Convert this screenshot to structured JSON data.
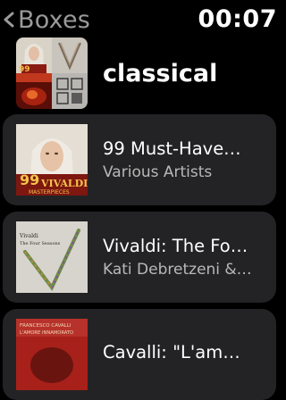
{
  "status_bar": {
    "back_label": "Boxes",
    "time": "00:07"
  },
  "header": {
    "title": "classical",
    "art_grid_icons": [
      "vivaldi-portrait-art",
      "violin-strings-art",
      "red-fire-art",
      "manuscript-art"
    ]
  },
  "albums": [
    {
      "title": "99 Must-Have…",
      "artist": "Various Artists",
      "cover_text": {
        "number": "99",
        "name": "VIVALDI",
        "sub": "MASTERPIECES"
      }
    },
    {
      "title": "Vivaldi: The Fo…",
      "artist": "Kati Debretzeni &…",
      "cover_text": {
        "line1": "Vivaldi",
        "line2": "The Four Seasons"
      }
    },
    {
      "title": "Cavalli: \"L'am…",
      "artist": "",
      "cover_text": {
        "line1": "FRANCESCO CAVALLI",
        "line2": "L'AMORE INNAMORATO"
      }
    }
  ],
  "colors": {
    "background": "#000000",
    "cell": "#232325",
    "secondary_text": "#b8b8b8",
    "back_label": "#9a9a9a"
  }
}
